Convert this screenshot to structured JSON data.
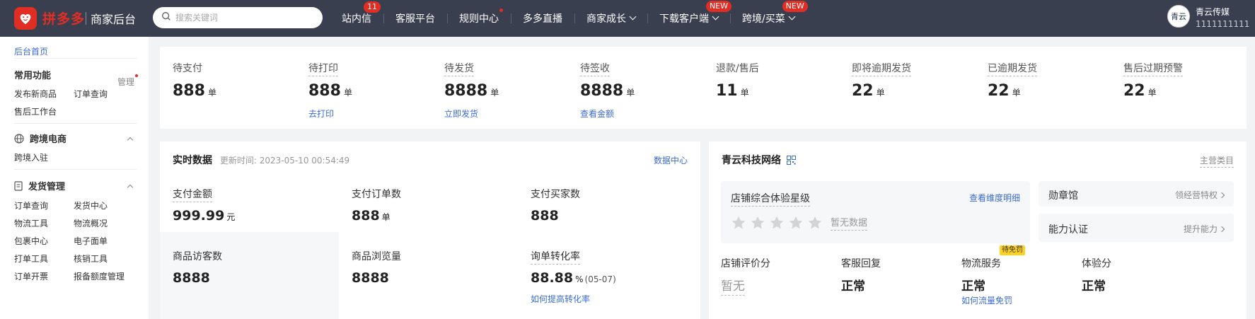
{
  "topnav": {
    "brand": "拼多多",
    "subtitle": "商家后台",
    "search_placeholder": "搜索关键词",
    "items": [
      {
        "label": "站内信",
        "badge": "11"
      },
      {
        "label": "客服平台"
      },
      {
        "label": "规则中心"
      },
      {
        "label": "多多直播"
      },
      {
        "label": "商家成长"
      },
      {
        "label": "下载客户端",
        "badge": "NEW"
      },
      {
        "label": "跨境/买菜",
        "badge": "NEW"
      }
    ],
    "user": {
      "name": "青云传媒",
      "id": "1111111111",
      "avatar_text": "青云"
    }
  },
  "sidebar": {
    "home": "后台首页",
    "common": {
      "title": "常用功能",
      "manage": "管理",
      "links": [
        "发布新商品",
        "订单查询",
        "售后工作台"
      ]
    },
    "crossborder": {
      "title": "跨境电商",
      "links": [
        "跨境入驻"
      ]
    },
    "shipping": {
      "title": "发货管理",
      "links": [
        "订单查询",
        "发货中心",
        "物流工具",
        "物流概况",
        "包裹中心",
        "电子面单",
        "打单工具",
        "核销工具",
        "订单开票",
        "报备额度管理"
      ]
    }
  },
  "order_stats": [
    {
      "label": "待支付",
      "value": "888",
      "unit": "单",
      "link": ""
    },
    {
      "label": "待打印",
      "value": "888",
      "unit": "单",
      "link": "去打印"
    },
    {
      "label": "待发货",
      "value": "8888",
      "unit": "单",
      "link": "立即发货"
    },
    {
      "label": "待签收",
      "value": "8888",
      "unit": "单",
      "link": "查看金额"
    },
    {
      "label": "退款/售后",
      "value": "11",
      "unit": "单",
      "link": ""
    },
    {
      "label": "即将逾期发货",
      "value": "22",
      "unit": "单",
      "link": ""
    },
    {
      "label": "已逾期发货",
      "value": "22",
      "unit": "单",
      "link": ""
    },
    {
      "label": "售后过期预警",
      "value": "22",
      "unit": "单",
      "link": ""
    }
  ],
  "realtime": {
    "title": "实时数据",
    "updated": "更新时间: 2023-05-10 00:54:49",
    "center_link": "数据中心",
    "metrics": [
      {
        "label": "支付金额",
        "value": "999.99",
        "unit": "元"
      },
      {
        "label": "支付订单数",
        "value": "888",
        "unit": "单"
      },
      {
        "label": "支付买家数",
        "value": "888",
        "unit": ""
      },
      {
        "label": "商品访客数",
        "value": "8888",
        "unit": ""
      },
      {
        "label": "商品浏览量",
        "value": "8888",
        "unit": ""
      },
      {
        "label": "询单转化率",
        "value": "88.88",
        "unit": "%",
        "sub": "(05-07)",
        "link": "如何提高转化率"
      }
    ]
  },
  "shop": {
    "name": "青云科技网络",
    "category_link": "主营类目",
    "experience": {
      "title": "店铺综合体验星级",
      "link": "查看维度明细",
      "no_data": "暂无数据",
      "stars": 0
    },
    "medal": {
      "title": "勋章馆",
      "link": "领经营特权"
    },
    "ability": {
      "title": "能力认证",
      "link": "提升能力"
    },
    "scores": [
      {
        "label": "店铺评价分",
        "value": "暂无"
      },
      {
        "label": "客服回复",
        "value": "正常"
      },
      {
        "label": "物流服务",
        "value": "正常",
        "tag": "待免罚",
        "link": "如何流量免罚"
      },
      {
        "label": "体验分",
        "value": "正常"
      }
    ]
  },
  "colors": {
    "nav_bg": "#3a3f50",
    "brand_red": "#e02e24",
    "link_blue": "#3b6bd6",
    "page_bg": "#f2f3f5"
  }
}
